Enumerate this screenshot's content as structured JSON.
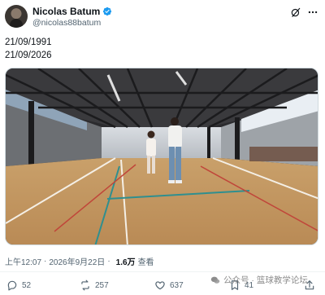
{
  "author": {
    "name": "Nicolas Batum",
    "handle": "@nicolas88batum",
    "verified": true
  },
  "tweet": {
    "lines": [
      "21/09/1991",
      "21/09/2026"
    ]
  },
  "meta": {
    "time": "上午12:07",
    "separator": "·",
    "date": "2026年9月22日",
    "views": "1.6万",
    "views_label": "查看"
  },
  "actions": {
    "replies": "52",
    "retweets": "257",
    "likes": "637",
    "bookmarks": "41"
  },
  "watermark": {
    "text": "公众号 · 篮球教学论坛"
  },
  "icons": {
    "verified": "verified-badge-icon",
    "grok": "grok-icon",
    "more": "more-icon",
    "reply": "reply-icon",
    "retweet": "retweet-icon",
    "like": "like-icon",
    "bookmark": "bookmark-icon",
    "share": "share-icon",
    "wechat": "wechat-icon"
  },
  "colors": {
    "accent": "#1d9bf0",
    "text": "#0f1419",
    "muted": "#536471"
  }
}
